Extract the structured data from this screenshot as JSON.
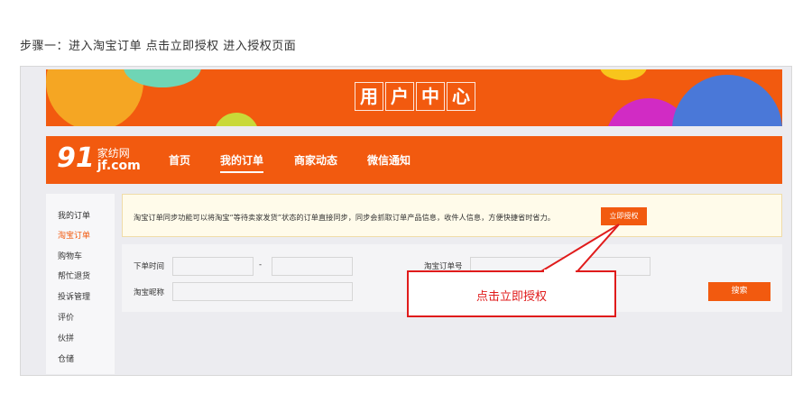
{
  "caption": "步骤一：进入淘宝订单 点击立即授权 进入授权页面",
  "banner": {
    "chars": [
      "用",
      "户",
      "中",
      "心"
    ]
  },
  "nav": {
    "logo_number": "91",
    "logo_cn": "家纺网",
    "logo_en": "jf.com",
    "items": [
      "首页",
      "我的订单",
      "商家动态",
      "微信通知"
    ],
    "active_index": 1
  },
  "sidebar": {
    "items": [
      "我的订单",
      "淘宝订单",
      "购物车",
      "帮忙退货",
      "投诉管理",
      "评价",
      "伙拼",
      "仓储"
    ],
    "active_index": 1
  },
  "notice": {
    "text": "淘宝订单同步功能可以将淘宝“等待卖家发货”状态的订单直接同步，同步会抓取订单产品信息，收件人信息，方便快捷省时省力。",
    "button": "立即授权"
  },
  "search": {
    "order_time_label": "下单时间",
    "range_separator": "-",
    "order_no_label": "淘宝订单号",
    "nickname_label": "淘宝昵称",
    "search_button": "搜索"
  },
  "callout": {
    "text": "点击立即授权",
    "color": "#e01b1b"
  },
  "colors": {
    "brand": "#f25a0f",
    "notice_bg": "#fffbea",
    "panel_bg": "#ececf0"
  }
}
